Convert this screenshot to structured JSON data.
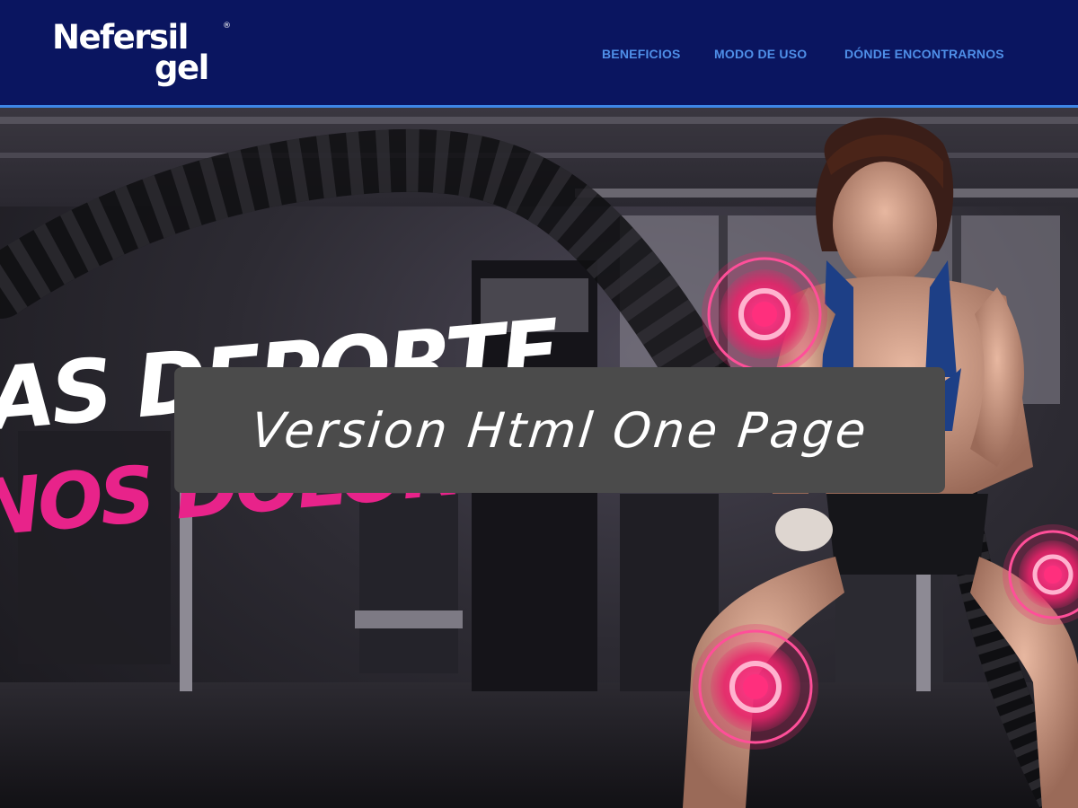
{
  "brand": {
    "logo_line1": "Nefersil",
    "logo_line2": "gel",
    "registered_mark": "®"
  },
  "nav": {
    "items": [
      {
        "label": "BENEFICIOS"
      },
      {
        "label": "MODO DE USO"
      },
      {
        "label": "DÓNDE ENCONTRARNOS"
      }
    ]
  },
  "hero": {
    "headline_white": "AS DEPORTE",
    "headline_pink": "NOS DOLOR"
  },
  "banner": {
    "text": "Version Html One Page"
  },
  "colors": {
    "header_bg": "#0a1560",
    "header_border": "#3d86e6",
    "nav_link": "#4f8fe8",
    "accent_pink": "#e8238a",
    "banner_bg": "#4b4b4b"
  }
}
